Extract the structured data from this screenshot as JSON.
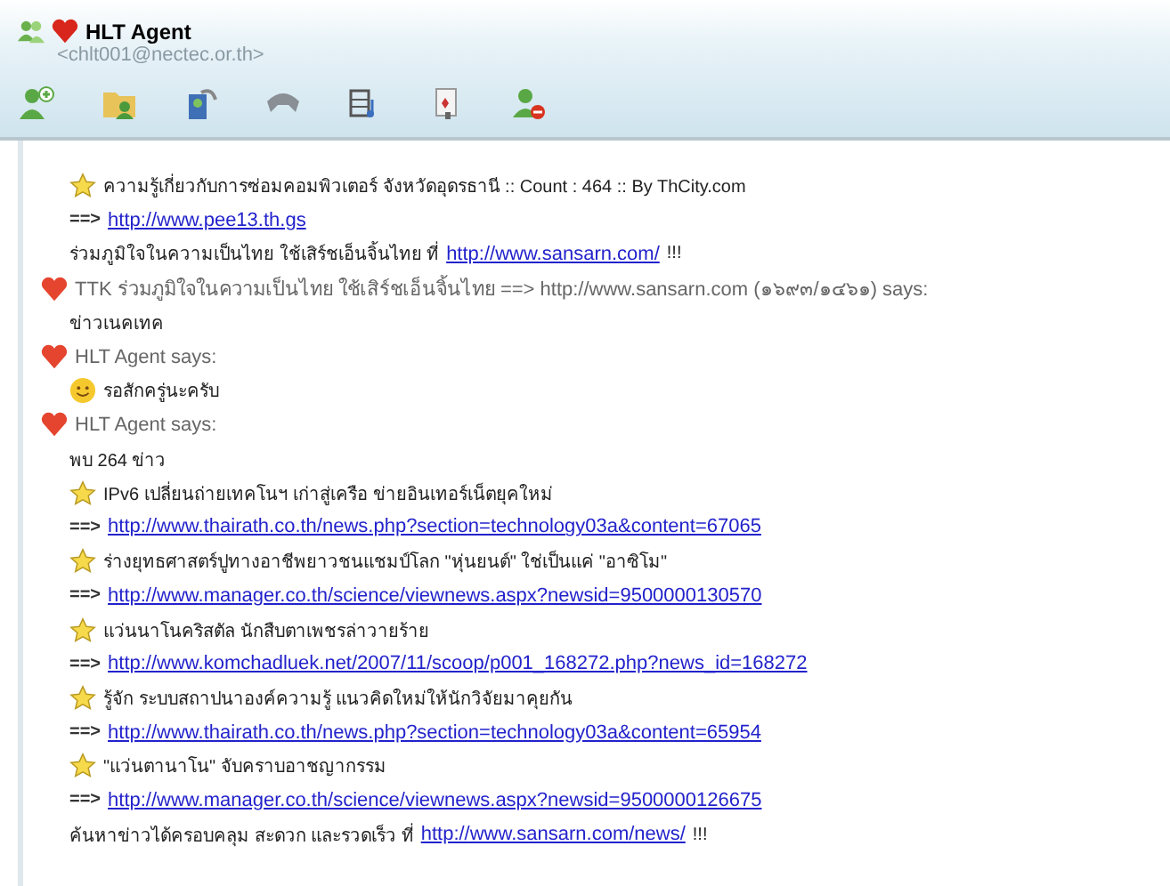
{
  "window": {
    "title": "HLT Agent",
    "subtitle": "<chlt001@nectec.or.th>"
  },
  "toolbar": [
    {
      "kind": "person-add"
    },
    {
      "kind": "folder"
    },
    {
      "kind": "contact"
    },
    {
      "kind": "phone"
    },
    {
      "kind": "media"
    },
    {
      "kind": "cards"
    },
    {
      "kind": "person-block"
    }
  ],
  "messages": [
    {
      "kind": "star",
      "text": "ความรู้เกี่ยวกับการซ่อมคอมพิวเตอร์ จังหวัดอุดรธานี :: Count : 464 :: By ThCity.com"
    },
    {
      "kind": "link",
      "arrow": "==>",
      "url": "http://www.pee13.th.gs"
    },
    {
      "kind": "text",
      "text": "ร่วมภูมิใจในความเป็นไทย ใช้เสิร์ชเอ็นจิ้นไทย  ที่",
      "url": "http://www.sansarn.com/",
      "suffix": "!!!"
    },
    {
      "kind": "sender",
      "text": "TTK ร่วมภูมิใจในความเป็นไทย ใช้เสิร์ชเอ็นจิ้นไทย ==> http://www.sansarn.com  (๑๖๙๓/๑๔๖๑) says:"
    },
    {
      "kind": "text",
      "text": "ข่าวเนคเทค"
    },
    {
      "kind": "sender",
      "text": "HLT Agent says:"
    },
    {
      "kind": "smiley",
      "text": "รอสักครู่นะครับ"
    },
    {
      "kind": "sender",
      "text": "HLT Agent says:"
    },
    {
      "kind": "text",
      "text": "พบ 264 ข่าว"
    },
    {
      "kind": "star",
      "text": "IPv6 เปลี่ยนถ่ายเทคโนฯ เก่าสู่เครือ ข่ายอินเทอร์เน็ตยุคใหม่"
    },
    {
      "kind": "link",
      "arrow": "==>",
      "url": "http://www.thairath.co.th/news.php?section=technology03a&content=67065"
    },
    {
      "kind": "star",
      "text": "ร่างยุทธศาสตร์ปูทางอาชีพยาวชนแชมป์โลก \"หุ่นยนต์\" ใช่เป็นแค่ \"อาซิโม\""
    },
    {
      "kind": "link",
      "arrow": "==>",
      "url": "http://www.manager.co.th/science/viewnews.aspx?newsid=9500000130570"
    },
    {
      "kind": "star",
      "text": "แว่นนาโนคริสตัล นักสืบตาเพชรล่าวายร้าย"
    },
    {
      "kind": "link",
      "arrow": "==>",
      "url": "http://www.komchadluek.net/2007/11/scoop/p001_168272.php?news_id=168272"
    },
    {
      "kind": "star",
      "text": "รู้จัก  ระบบสถาปนาองค์ความรู้ แนวคิดใหม่ให้นักวิจัยมาคุยกัน"
    },
    {
      "kind": "link",
      "arrow": "==>",
      "url": "http://www.thairath.co.th/news.php?section=technology03a&content=65954"
    },
    {
      "kind": "star",
      "text": "\"แว่นตานาโน\" จับคราบอาชญากรรม"
    },
    {
      "kind": "link",
      "arrow": "==>",
      "url": "http://www.manager.co.th/science/viewnews.aspx?newsid=9500000126675"
    },
    {
      "kind": "text",
      "text": "ค้นหาข่าวได้ครอบคลุม สะดวก และรวดเร็ว ที่",
      "url": "http://www.sansarn.com/news/",
      "suffix": "!!!"
    }
  ]
}
